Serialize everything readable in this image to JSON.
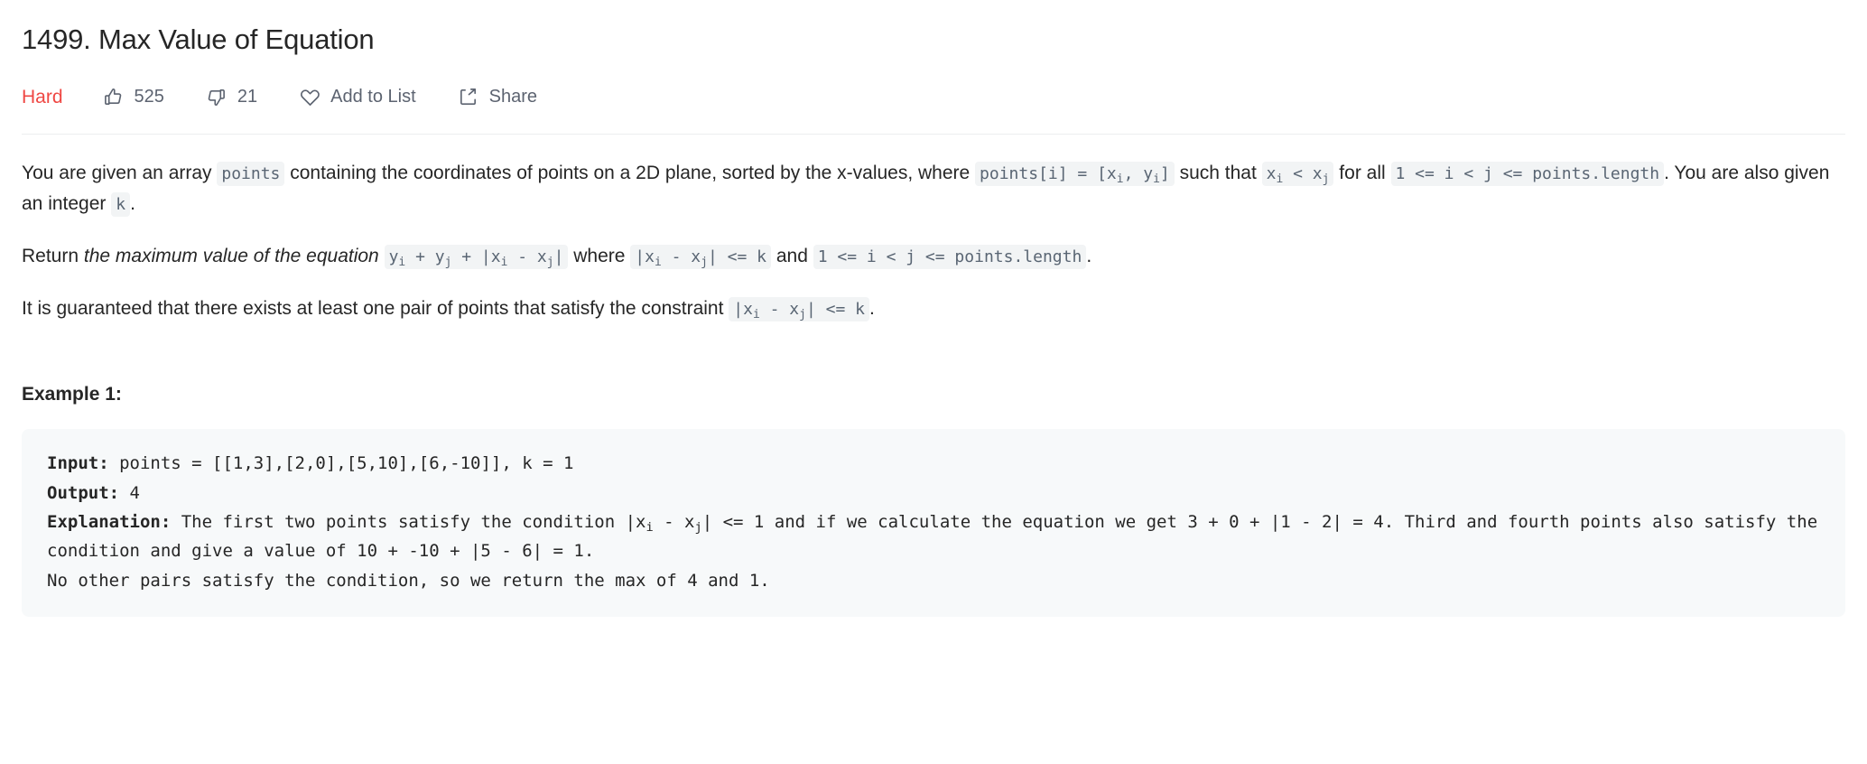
{
  "problem": {
    "title": "1499. Max Value of Equation",
    "difficulty": "Hard",
    "difficulty_color": "#ef4743"
  },
  "actions": {
    "likes": "525",
    "dislikes": "21",
    "add_to_list": "Add to List",
    "share": "Share",
    "icons": {
      "like": "thumbs-up-icon",
      "dislike": "thumbs-down-icon",
      "favorite": "heart-icon",
      "share": "share-icon"
    }
  },
  "description": {
    "p1": {
      "t1": "You are given an array ",
      "c1": "points",
      "t2": " containing the coordinates of points on a 2D plane, sorted by the x-values, where ",
      "c2_pre": "points[i] = [x",
      "c2_sub1": "i",
      "c2_mid": ", y",
      "c2_sub2": "i",
      "c2_post": "]",
      "t3": " such that ",
      "c3_pre": "x",
      "c3_sub1": "i",
      "c3_mid": " < x",
      "c3_sub2": "j",
      "t4": " for all ",
      "c4": "1 <= i < j <= points.length",
      "t5": ". You are also given an integer ",
      "c5": "k",
      "t6": "."
    },
    "p2": {
      "t1": "Return ",
      "em1": "the maximum value of the equation",
      "t2": " ",
      "c1_pre": "y",
      "c1_sub1": "i",
      "c1_m1": " + y",
      "c1_sub2": "j",
      "c1_m2": " + |x",
      "c1_sub3": "i",
      "c1_m3": " - x",
      "c1_sub4": "j",
      "c1_post": "|",
      "t3": " where ",
      "c2_pre": "|x",
      "c2_sub1": "i",
      "c2_mid": " - x",
      "c2_sub2": "j",
      "c2_post": "| <= k",
      "t4": " and ",
      "c3": "1 <= i < j <= points.length",
      "t5": "."
    },
    "p3": {
      "t1": "It is guaranteed that there exists at least one pair of points that satisfy the constraint ",
      "c1_pre": "|x",
      "c1_sub1": "i",
      "c1_mid": " - x",
      "c1_sub2": "j",
      "c1_post": "| <= k",
      "t2": "."
    }
  },
  "example1": {
    "heading": "Example 1:",
    "input_label": "Input:",
    "input_value": " points = [[1,3],[2,0],[5,10],[6,-10]], k = 1",
    "output_label": "Output:",
    "output_value": " 4",
    "explanation_label": "Explanation:",
    "explanation_part1": " The first two points satisfy the condition |x",
    "explanation_sub1": "i",
    "explanation_part2": " - x",
    "explanation_sub2": "j",
    "explanation_part3": "| <= 1 and if we calculate the equation we get 3 + 0 + |1 - 2| = 4. Third and fourth points also satisfy the condition and give a value of 10 + -10 + |5 - 6| = 1.\nNo other pairs satisfy the condition, so we return the max of 4 and 1."
  }
}
